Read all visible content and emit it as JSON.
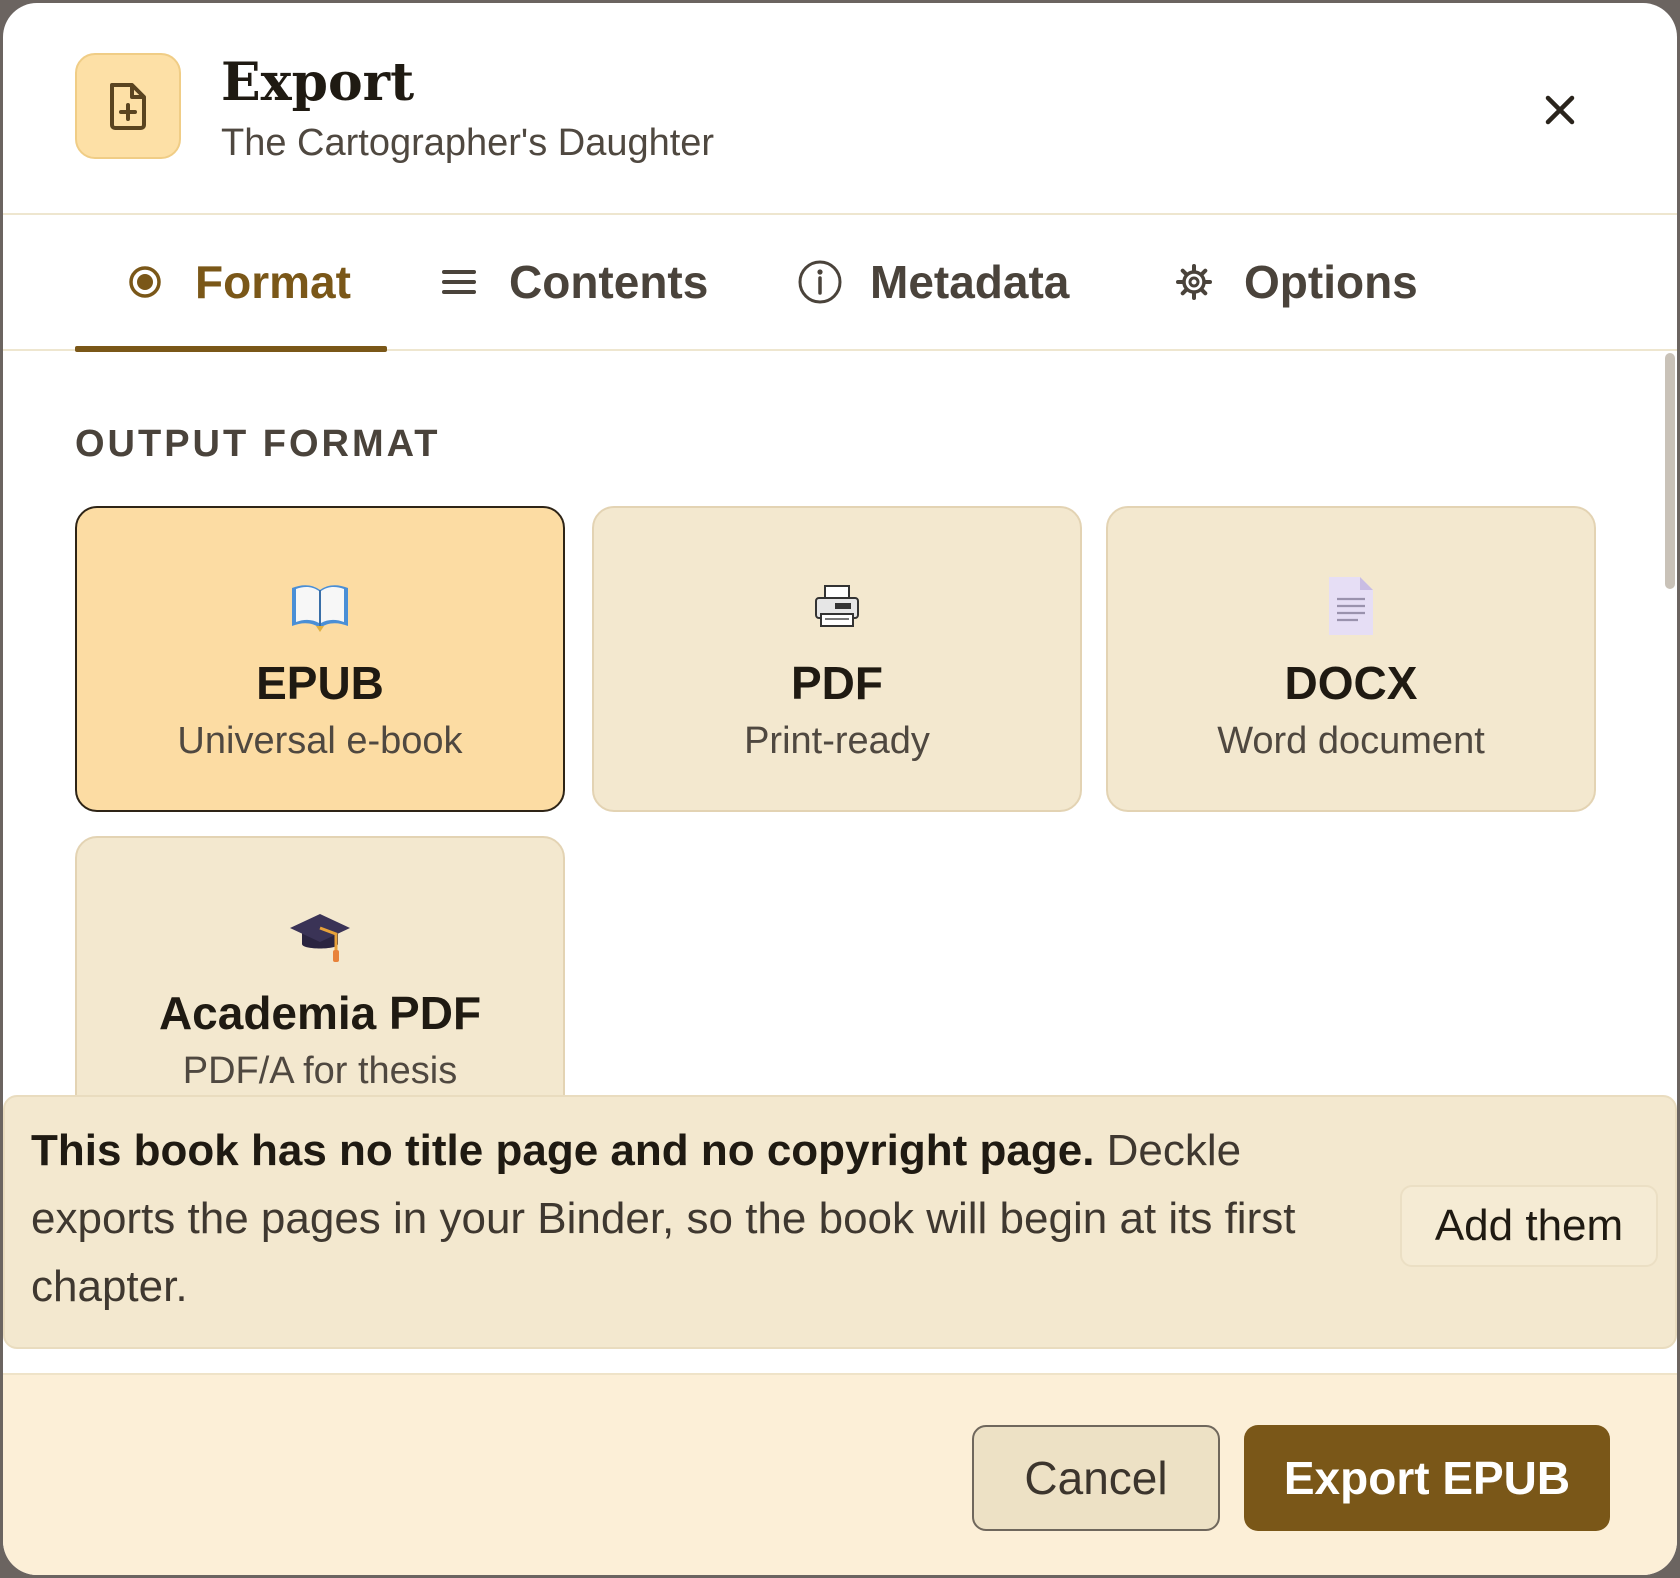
{
  "header": {
    "title": "Export",
    "subtitle": "The Cartographer's Daughter",
    "icon": "file-plus-icon",
    "close_icon": "close-icon"
  },
  "tabs": [
    {
      "label": "Format",
      "icon": "radio-icon",
      "active": true
    },
    {
      "label": "Contents",
      "icon": "list-icon",
      "active": false
    },
    {
      "label": "Metadata",
      "icon": "info-icon",
      "active": false
    },
    {
      "label": "Options",
      "icon": "gear-icon",
      "active": false
    }
  ],
  "format_section": {
    "label": "OUTPUT FORMAT",
    "formats": [
      {
        "name": "EPUB",
        "desc": "Universal e-book",
        "icon": "open-book-icon",
        "selected": true
      },
      {
        "name": "PDF",
        "desc": "Print-ready",
        "icon": "printer-icon",
        "selected": false
      },
      {
        "name": "DOCX",
        "desc": "Word document",
        "icon": "document-icon",
        "selected": false
      },
      {
        "name": "Academia PDF",
        "desc": "PDF/A for thesis",
        "icon": "graduation-cap-icon",
        "selected": false
      }
    ]
  },
  "banner": {
    "bold_text": "This book has no title page and no copyright page.",
    "text": " Deckle exports the pages in your Binder, so the book will begin at its first chapter.",
    "action_label": "Add them"
  },
  "footer": {
    "cancel_label": "Cancel",
    "export_label": "Export EPUB"
  },
  "colors": {
    "accent": "#7a5718",
    "selected_card": "#fcdca3",
    "card": "#f3e8cf",
    "footer_bg": "#fcefd7"
  }
}
